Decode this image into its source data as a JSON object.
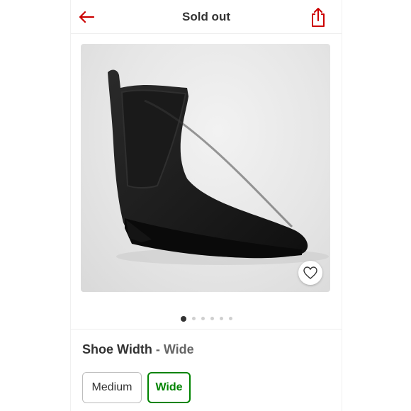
{
  "header": {
    "title": "Sold out",
    "back_icon": "arrow-left-icon",
    "share_icon": "share-icon",
    "accent_color": "#cc0000"
  },
  "gallery": {
    "image_subject": "black chelsea rain boot",
    "favorite_icon": "heart-icon",
    "dot_count": 6,
    "active_dot": 1
  },
  "variant": {
    "label": "Shoe Width",
    "separator": " - ",
    "selected_value": "Wide",
    "options": [
      {
        "label": "Medium",
        "selected": false
      },
      {
        "label": "Wide",
        "selected": true
      }
    ],
    "selected_color": "#008300"
  }
}
